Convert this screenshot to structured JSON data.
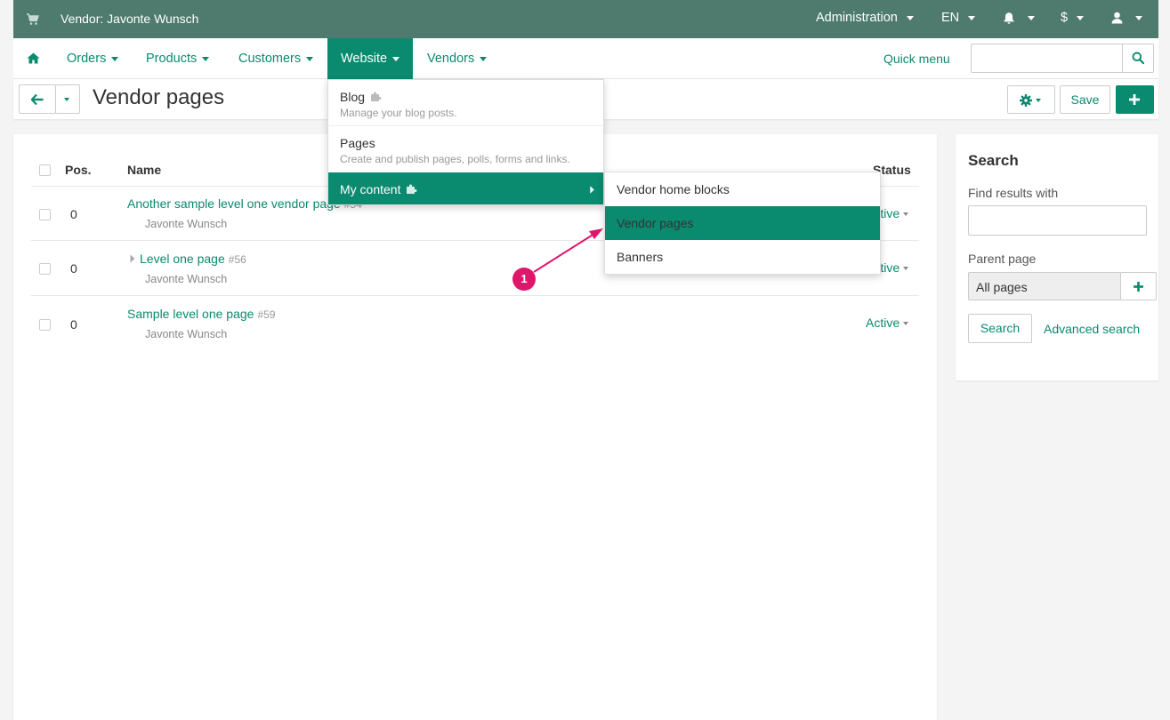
{
  "topbar": {
    "vendor_label": "Vendor: Javonte Wunsch",
    "administration": "Administration",
    "language": "EN",
    "currency": "$"
  },
  "nav": {
    "orders": "Orders",
    "products": "Products",
    "customers": "Customers",
    "website": "Website",
    "vendors": "Vendors",
    "quick_menu": "Quick menu",
    "search_value": ""
  },
  "titlebar": {
    "title": "Vendor pages",
    "save": "Save"
  },
  "table": {
    "headers": {
      "pos": "Pos.",
      "name": "Name",
      "status": "Status"
    },
    "rows": [
      {
        "pos": "0",
        "name": "Another sample level one vendor page",
        "id": "#54",
        "owner": "Javonte Wunsch",
        "status": "Active"
      },
      {
        "pos": "0",
        "name": "Level one page",
        "id": "#56",
        "owner": "Javonte Wunsch",
        "status": "Active"
      },
      {
        "pos": "0",
        "name": "Sample level one page",
        "id": "#59",
        "owner": "Javonte Wunsch",
        "status": "Active"
      }
    ]
  },
  "sidebar": {
    "title": "Search",
    "find_label": "Find results with",
    "find_value": "",
    "parent_label": "Parent page",
    "parent_value": "All pages",
    "search_button": "Search",
    "advanced": "Advanced search"
  },
  "website_menu": {
    "items": [
      {
        "title": "Blog",
        "desc": "Manage your blog posts."
      },
      {
        "title": "Pages",
        "desc": "Create and publish pages, polls, forms and links."
      },
      {
        "title": "My content",
        "desc": ""
      }
    ]
  },
  "submenu": {
    "items": [
      "Vendor home blocks",
      "Vendor pages",
      "Banners"
    ]
  },
  "annotation": {
    "label": "1"
  },
  "colors": {
    "primary": "#0a8a6f",
    "topbar": "#4e7b6d",
    "annotation": "#e0166b"
  }
}
